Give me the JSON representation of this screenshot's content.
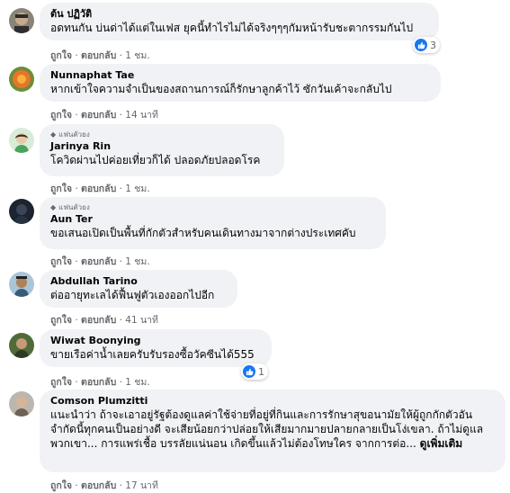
{
  "comments": [
    {
      "name": "ต้น ปฏิวัติ",
      "fan_badge": "",
      "text": "อดทนกัน บ่นด่าได้แต่ในเฟส ยุคนี้ทำไรไม่ได้จริงๆๆๆกัมหน้ารับชะตากรรมกันไป",
      "like_label": "ถูกใจ",
      "reply_label": "ตอบกลับ",
      "time": "1 ชม.",
      "reaction_count": "3"
    },
    {
      "name": "Nunnaphat Tae",
      "fan_badge": "",
      "text": "หากเข้าใจความจำเป็นของสถานการณ์ก็รักษาลูกค้าไว้ ซักวันเค้าจะกลับไป",
      "like_label": "ถูกใจ",
      "reply_label": "ตอบกลับ",
      "time": "14 นาที"
    },
    {
      "name": "Jarinya Rin",
      "fan_badge": "แฟนตัวยง",
      "text": "โควิดผ่านไปค่อยเที่ยวก็ได้ ปลอดภัยปลอดโรค",
      "like_label": "ถูกใจ",
      "reply_label": "ตอบกลับ",
      "time": "1 ชม."
    },
    {
      "name": "Aun Ter",
      "fan_badge": "แฟนตัวยง",
      "text": "ขอเสนอเปิดเป็นพื้นที่กักตัวสำหรับคนเดินทางมาจากต่างประเทศคับ",
      "like_label": "ถูกใจ",
      "reply_label": "ตอบกลับ",
      "time": "1 ชม."
    },
    {
      "name": "Abdullah Tarino",
      "fan_badge": "",
      "text": "ต่ออายุทะเลได้ฟื้นฟูตัวเองออกไปอีก",
      "like_label": "ถูกใจ",
      "reply_label": "ตอบกลับ",
      "time": "41 นาที"
    },
    {
      "name": "Wiwat Boonying",
      "fan_badge": "",
      "text": "ขายเรือค่าน้ำเลยครับรับรองซื้อวัคซีนได้555",
      "like_label": "ถูกใจ",
      "reply_label": "ตอบกลับ",
      "time": "1 ชม.",
      "reaction_count": "1"
    },
    {
      "name": "Comson Plumzitti",
      "fan_badge": "",
      "text": "แนะนำว่า ถ้าจะเอาอยู่รัฐต้องดูแลค่าใช้จ่ายที่อยู่ที่กินและการรักษาสุขอนามัยให้ผู้ถูกกักตัวอันจำกัดนี้ทุกคนเป็นอย่างดี จะเสียน้อยกว่าปล่อยให้เสียมากมายปลายกลายเป็นโง่เขลา. ถ้าไม่ดูแลพวกเขา... การแพร่เชื้อ บรรลัยแน่นอน เกิดขึ้นแล้วไม่ต้องโทษใคร จากการต่อ...",
      "see_more": "ดูเพิ่มเติม",
      "like_label": "ถูกใจ",
      "reply_label": "ตอบกลับ",
      "time": "17 นาที"
    }
  ],
  "colors": {
    "bubble": "#f0f2f5",
    "meta_text": "#65676b",
    "like_blue": "#1877f2"
  },
  "icons": {
    "fan_badge": "diamond-icon",
    "reaction": "thumbs-up-icon"
  }
}
